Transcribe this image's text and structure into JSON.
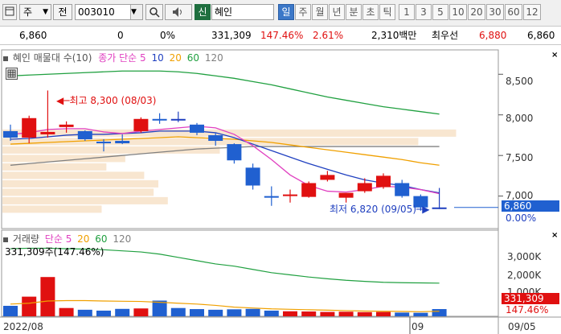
{
  "toolbar": {
    "market_label": "주",
    "all_label": "전",
    "code_value": "003010",
    "search_icon": "magnifier-icon",
    "sound_icon": "speaker-icon",
    "credit_badge": "신",
    "stock_name": "혜인",
    "periods": [
      "일",
      "주",
      "월",
      "년",
      "분",
      "초",
      "틱",
      "1",
      "3",
      "5",
      "10",
      "20",
      "30",
      "60",
      "12"
    ],
    "active_period": "일"
  },
  "pricebar": {
    "price": "6,860",
    "change": "0",
    "change_pct": "0%",
    "volume": "331,309",
    "volume_ratio": "147.46%",
    "turnover": "2.61%",
    "amount": "2,310백만",
    "best_ask_label": "최우선",
    "best_ask": "6,880",
    "best_bid": "6,860"
  },
  "price_pane": {
    "name_label": "혜인",
    "profile_label": "매물대",
    "profile_count": "수(10)",
    "ma_label": "종가 단순",
    "ma_periods": [
      "5",
      "10",
      "20",
      "60",
      "120"
    ],
    "ma_colors": [
      "#e040c0",
      "#2040c0",
      "#f0a000",
      "#20a040",
      "#808080"
    ],
    "high_annotation": "최고 8,300 (08/03)",
    "low_annotation": "최저 6,820 (09/05)",
    "y_ticks": [
      "8,500",
      "8,000",
      "7,500",
      "7,000"
    ],
    "current_price_box": "6,860",
    "current_change_box": "0.00%"
  },
  "volume_pane": {
    "title": "거래량",
    "ma_label": "단순",
    "ma_periods": [
      "5",
      "20",
      "60",
      "120"
    ],
    "volume_text": "331,309주(147.46%)",
    "y_ticks": [
      "3,000K",
      "2,000K",
      "1,000K"
    ],
    "current_volume_box": "331,309",
    "current_ratio_box": "147.46%"
  },
  "date_axis": {
    "left_label": "2022/08",
    "mid_label": "09",
    "right_label": "09/05"
  },
  "chart_data": {
    "type": "candlestick",
    "ylim": [
      6600,
      8800
    ],
    "candles": [
      {
        "o": 7800,
        "h": 7880,
        "l": 7680,
        "c": 7720
      },
      {
        "o": 7720,
        "h": 7990,
        "l": 7650,
        "c": 7960
      },
      {
        "o": 7760,
        "h": 8300,
        "l": 7720,
        "c": 7790
      },
      {
        "o": 7850,
        "h": 7920,
        "l": 7780,
        "c": 7880
      },
      {
        "o": 7800,
        "h": 7810,
        "l": 7680,
        "c": 7700
      },
      {
        "o": 7670,
        "h": 7700,
        "l": 7550,
        "c": 7650
      },
      {
        "o": 7680,
        "h": 7760,
        "l": 7640,
        "c": 7650
      },
      {
        "o": 7800,
        "h": 7970,
        "l": 7780,
        "c": 7950
      },
      {
        "o": 7950,
        "h": 8020,
        "l": 7890,
        "c": 7940
      },
      {
        "o": 7950,
        "h": 8040,
        "l": 7910,
        "c": 7950
      },
      {
        "o": 7880,
        "h": 7900,
        "l": 7750,
        "c": 7780
      },
      {
        "o": 7750,
        "h": 7780,
        "l": 7620,
        "c": 7680
      },
      {
        "o": 7640,
        "h": 7650,
        "l": 7400,
        "c": 7440
      },
      {
        "o": 7350,
        "h": 7400,
        "l": 7080,
        "c": 7130
      },
      {
        "o": 7000,
        "h": 7120,
        "l": 6880,
        "c": 6990
      },
      {
        "o": 7000,
        "h": 7080,
        "l": 6920,
        "c": 7020
      },
      {
        "o": 6990,
        "h": 7180,
        "l": 6980,
        "c": 7160
      },
      {
        "o": 7200,
        "h": 7310,
        "l": 7180,
        "c": 7260
      },
      {
        "o": 6980,
        "h": 7020,
        "l": 6920,
        "c": 7040
      },
      {
        "o": 7060,
        "h": 7220,
        "l": 7040,
        "c": 7160
      },
      {
        "o": 7110,
        "h": 7280,
        "l": 7090,
        "c": 7250
      },
      {
        "o": 7160,
        "h": 7200,
        "l": 6980,
        "c": 7000
      },
      {
        "o": 7000,
        "h": 7020,
        "l": 6820,
        "c": 6860
      },
      {
        "o": 6860,
        "h": 7100,
        "l": 6840,
        "c": 6860
      }
    ],
    "ma5": [
      7760,
      7780,
      7820,
      7830,
      7830,
      7790,
      7770,
      7800,
      7820,
      7840,
      7860,
      7840,
      7760,
      7620,
      7450,
      7260,
      7130,
      7060,
      7050,
      7080,
      7120,
      7110,
      7080,
      7030
    ],
    "ma10": [
      7700,
      7710,
      7730,
      7750,
      7760,
      7760,
      7770,
      7780,
      7800,
      7800,
      7800,
      7780,
      7720,
      7640,
      7560,
      7480,
      7400,
      7330,
      7260,
      7200,
      7160,
      7130,
      7080,
      7040
    ],
    "ma20": [
      7640,
      7650,
      7660,
      7670,
      7680,
      7690,
      7700,
      7710,
      7720,
      7730,
      7720,
      7710,
      7700,
      7680,
      7660,
      7630,
      7600,
      7570,
      7540,
      7510,
      7480,
      7450,
      7410,
      7380
    ],
    "ma60": [
      8480,
      8490,
      8500,
      8510,
      8520,
      8530,
      8540,
      8540,
      8540,
      8530,
      8510,
      8480,
      8450,
      8410,
      8370,
      8320,
      8270,
      8220,
      8180,
      8140,
      8100,
      8070,
      8040,
      8010
    ],
    "ma120": [
      7380,
      7400,
      7420,
      7440,
      7460,
      7480,
      7500,
      7520,
      7540,
      7560,
      7580,
      7590,
      7600,
      7610,
      7610,
      7610,
      7610,
      7610,
      7610,
      7610,
      7610,
      7610,
      7610,
      7610
    ],
    "volumes_k": [
      480,
      900,
      1800,
      380,
      300,
      260,
      340,
      360,
      720,
      380,
      330,
      300,
      320,
      340,
      260,
      230,
      220,
      200,
      210,
      190,
      200,
      170,
      160,
      331
    ],
    "vol_ma5": [
      560,
      600,
      700,
      720,
      720,
      700,
      690,
      680,
      640,
      600,
      560,
      500,
      420,
      380,
      340,
      320,
      300,
      280,
      260,
      240,
      230,
      220,
      210,
      230
    ],
    "vol_ma20": [
      3100,
      3120,
      3120,
      3100,
      3080,
      3050,
      3000,
      2950,
      2850,
      2700,
      2550,
      2400,
      2300,
      2150,
      2000,
      1900,
      1800,
      1720,
      1650,
      1600,
      1560,
      1540,
      1530,
      1520
    ],
    "profile_widths": [
      0.96,
      0.88,
      0.46,
      0.26,
      0.22,
      0.3,
      0.33,
      0.32,
      0.35,
      0.21
    ]
  }
}
